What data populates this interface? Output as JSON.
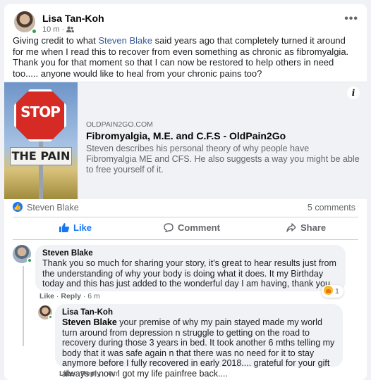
{
  "post": {
    "author": "Lisa Tan-Koh",
    "time": "10 m",
    "audience_icon": "friends-icon",
    "text_before_mention": "Giving credit to what ",
    "mention": "Steven Blake",
    "text_after_mention": " said years ago that completely turned it around for me when I read this to recover from even something as chronic as fibromyalgia. Thank you for that moment so that I can now be restored to help others in need too..... anyone would like to heal from your chronic pains too?"
  },
  "link_preview": {
    "image_sign_top": "STOP",
    "image_sign_bottom": "THE PAIN",
    "domain": "OLDPAIN2GO.COM",
    "title": "Fibromyalgia, M.E. and C.F.S - OldPain2Go",
    "description": "Steven describes his personal theory of why people have Fibromyalgia ME and CFS. He also suggests a way you might be able to free yourself of it."
  },
  "stats": {
    "reactor": "Steven Blake",
    "comments": "5 comments"
  },
  "actions": {
    "like": "Like",
    "comment": "Comment",
    "share": "Share"
  },
  "comments": [
    {
      "author": "Steven Blake",
      "text": "Thank you so much for sharing your story, it's great to hear results just from the understanding of why your body is doing what it does. It my Birthday today and this has just added to the wonderful day I am having, thank you.",
      "like": "Like",
      "reply": "Reply",
      "time": "6 m",
      "reaction_count": "1"
    },
    {
      "author": "Lisa Tan-Koh",
      "mention": "Steven Blake",
      "text": " your premise of why my pain stayed made my world turn around from depression n struggle to getting on the road to recovery during those 3 years in bed. It took another 6 mths telling my body that it was safe again n that there was no need for it to stay anymore before I fully recovered in early 2018.... grateful for your gift always n now I got my life painfree back....",
      "like": "Like",
      "reply": "Reply",
      "time": "4 m"
    }
  ],
  "colors": {
    "accent": "#1877f2",
    "mention_link": "#385898",
    "online": "#31a24c",
    "bubble": "#f0f2f5"
  }
}
